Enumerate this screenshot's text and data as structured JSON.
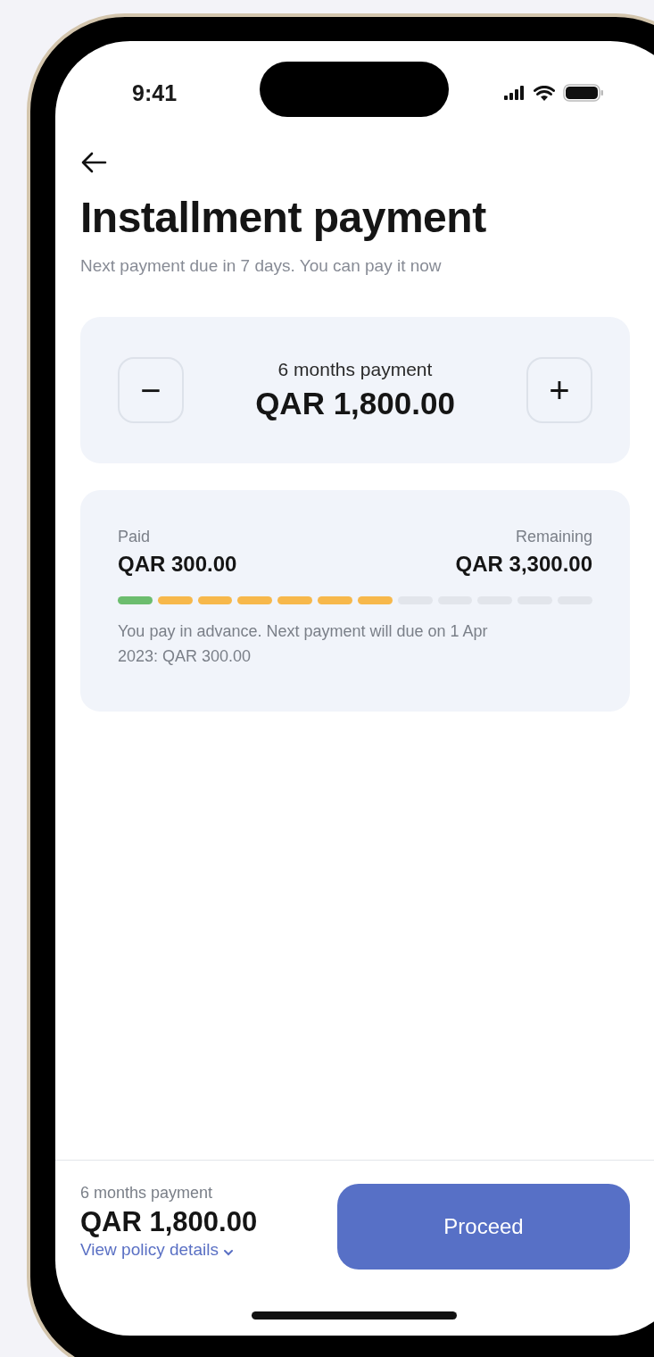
{
  "status_bar": {
    "time": "9:41"
  },
  "title": "Installment payment",
  "subtitle": "Next payment due in 7 days. You can pay it now",
  "stepper": {
    "label": "6 months payment",
    "amount": "QAR 1,800.00",
    "decrement": "−",
    "increment": "+"
  },
  "progress": {
    "paid_label": "Paid",
    "paid_amount": "QAR 300.00",
    "remaining_label": "Remaining",
    "remaining_amount": "QAR 3,300.00",
    "segments": [
      {
        "color": "#6cbd6e"
      },
      {
        "color": "#f7b84b"
      },
      {
        "color": "#f7b84b"
      },
      {
        "color": "#f7b84b"
      },
      {
        "color": "#f7b84b"
      },
      {
        "color": "#f7b84b"
      },
      {
        "color": "#f7b84b"
      },
      {
        "color": "#e2e5eb"
      },
      {
        "color": "#e2e5eb"
      },
      {
        "color": "#e2e5eb"
      },
      {
        "color": "#e2e5eb"
      },
      {
        "color": "#e2e5eb"
      }
    ],
    "note": "You pay in advance. Next payment will due on 1 Apr 2023: QAR 300.00"
  },
  "footer": {
    "label": "6 months payment",
    "amount": "QAR 1,800.00",
    "link": "View policy details",
    "button": "Proceed"
  }
}
